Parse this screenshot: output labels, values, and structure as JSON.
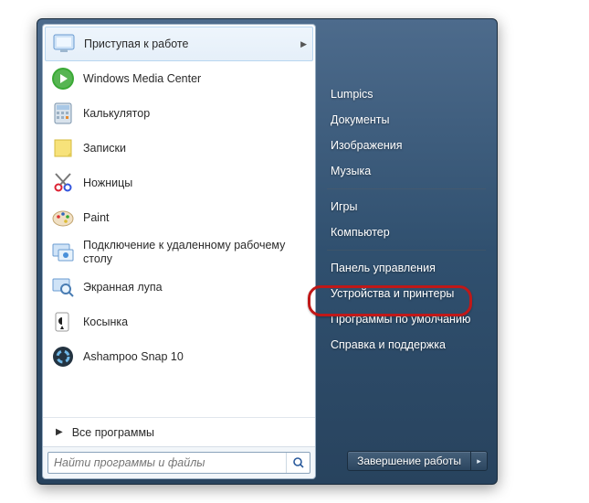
{
  "programs": [
    {
      "label": "Приступая к работе",
      "icon": "getting-started-icon",
      "hasSubmenu": true
    },
    {
      "label": "Windows Media Center",
      "icon": "media-center-icon"
    },
    {
      "label": "Калькулятор",
      "icon": "calculator-icon"
    },
    {
      "label": "Записки",
      "icon": "sticky-notes-icon"
    },
    {
      "label": "Ножницы",
      "icon": "snipping-tool-icon"
    },
    {
      "label": "Paint",
      "icon": "paint-icon"
    },
    {
      "label": "Подключение к удаленному рабочему столу",
      "icon": "remote-desktop-icon"
    },
    {
      "label": "Экранная лупа",
      "icon": "magnifier-icon"
    },
    {
      "label": "Косынка",
      "icon": "solitaire-icon"
    },
    {
      "label": "Ashampoo Snap 10",
      "icon": "ashampoo-snap-icon"
    }
  ],
  "allPrograms": {
    "label": "Все программы"
  },
  "search": {
    "placeholder": "Найти программы и файлы"
  },
  "rightColumn": {
    "group1": [
      {
        "label": "Lumpics"
      },
      {
        "label": "Документы"
      },
      {
        "label": "Изображения"
      },
      {
        "label": "Музыка"
      }
    ],
    "group2": [
      {
        "label": "Игры"
      },
      {
        "label": "Компьютер"
      }
    ],
    "group3": [
      {
        "label": "Панель управления",
        "highlighted": true
      },
      {
        "label": "Устройства и принтеры"
      },
      {
        "label": "Программы по умолчанию"
      },
      {
        "label": "Справка и поддержка"
      }
    ]
  },
  "shutdown": {
    "label": "Завершение работы"
  }
}
